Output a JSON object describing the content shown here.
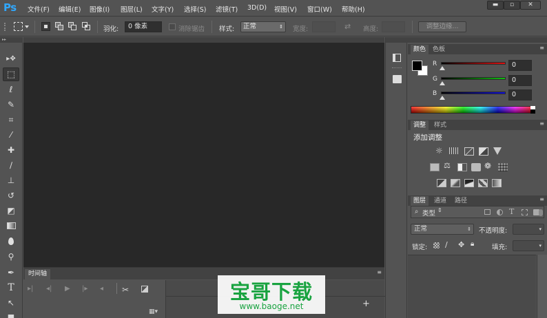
{
  "app": {
    "logo": "Ps"
  },
  "menu": {
    "items": [
      "文件(F)",
      "编辑(E)",
      "图像(I)",
      "图层(L)",
      "文字(Y)",
      "选择(S)",
      "滤镜(T)",
      "3D(D)",
      "视图(V)",
      "窗口(W)",
      "帮助(H)"
    ]
  },
  "window_controls": {
    "minimize": "▬",
    "maximize": "▫",
    "close": "✕"
  },
  "options": {
    "feather_label": "羽化:",
    "feather_value": "0 像素",
    "antialias_label": "消除锯齿",
    "style_label": "样式:",
    "style_value": "正常",
    "width_label": "宽度:",
    "height_label": "高度:",
    "refine_edge_button": "调整边缘..."
  },
  "tools": [
    {
      "name": "move-tool",
      "glyph": "▸✥"
    },
    {
      "name": "rect-marquee-tool",
      "glyph": "⬚"
    },
    {
      "name": "lasso-tool",
      "glyph": "ℓ"
    },
    {
      "name": "quick-selection-tool",
      "glyph": "✎"
    },
    {
      "name": "crop-tool",
      "glyph": "⌗"
    },
    {
      "name": "eyedropper-tool",
      "glyph": "⁄"
    },
    {
      "name": "healing-brush-tool",
      "glyph": "✚"
    },
    {
      "name": "brush-tool",
      "glyph": "∕"
    },
    {
      "name": "clone-stamp-tool",
      "glyph": "⊥"
    },
    {
      "name": "history-brush-tool",
      "glyph": "↺"
    },
    {
      "name": "eraser-tool",
      "glyph": "◩"
    },
    {
      "name": "gradient-tool",
      "glyph": "▬"
    },
    {
      "name": "blur-tool",
      "glyph": "●"
    },
    {
      "name": "dodge-tool",
      "glyph": "⚲"
    },
    {
      "name": "pen-tool",
      "glyph": "✒"
    },
    {
      "name": "type-tool",
      "glyph": "T"
    },
    {
      "name": "path-selection-tool",
      "glyph": "↖"
    },
    {
      "name": "shape-tool",
      "glyph": "■"
    }
  ],
  "timeline": {
    "tab": "时间轴"
  },
  "color_panel": {
    "tabs": [
      "颜色",
      "色板"
    ],
    "channels": [
      {
        "label": "R",
        "value": "0",
        "color": "#d02020"
      },
      {
        "label": "G",
        "value": "0",
        "color": "#20b020"
      },
      {
        "label": "B",
        "value": "0",
        "color": "#2020d0"
      }
    ],
    "foreground_color": "#000000",
    "background_color": "#ffffff"
  },
  "adjustments_panel": {
    "tabs": [
      "调整",
      "样式"
    ],
    "title": "添加调整"
  },
  "layers_panel": {
    "tabs": [
      "图层",
      "通道",
      "路径"
    ],
    "filter_label": "类型",
    "blend_mode": "正常",
    "opacity_label": "不透明度:",
    "lock_label": "锁定:",
    "fill_label": "填充:"
  },
  "watermark": {
    "title": "宝哥下载",
    "url": "www.baoge.net"
  }
}
